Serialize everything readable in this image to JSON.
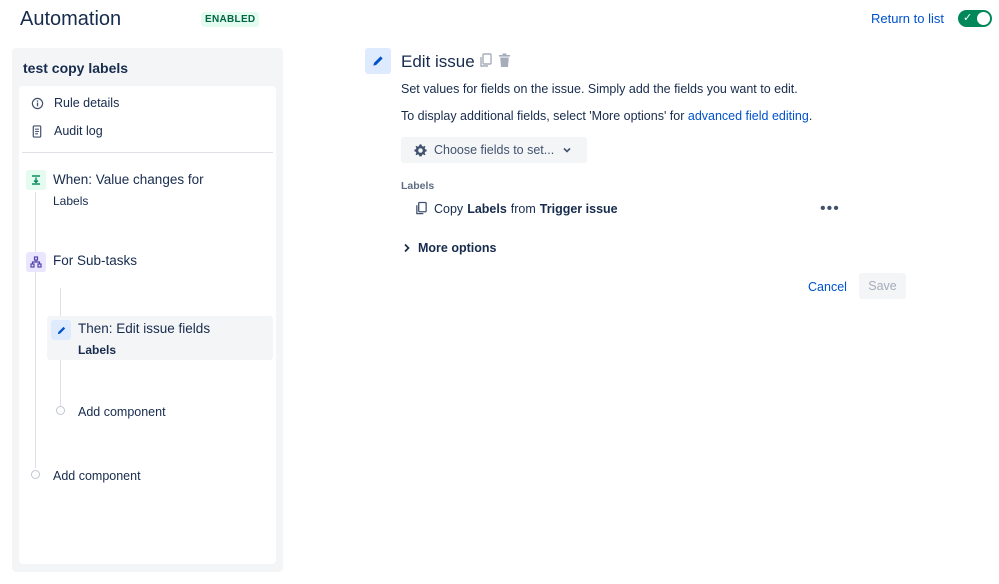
{
  "header": {
    "title": "Automation",
    "status": "ENABLED",
    "return_label": "Return to list",
    "toggle_on": true
  },
  "sidebar": {
    "rule_name": "test copy labels",
    "items": [
      {
        "label": "Rule details",
        "icon": "info-icon"
      },
      {
        "label": "Audit log",
        "icon": "document-icon"
      }
    ],
    "trigger": {
      "label": "When: Value changes for",
      "detail": "Labels",
      "icon": "trigger-icon"
    },
    "branch": {
      "label": "For Sub-tasks",
      "icon": "branch-icon"
    },
    "action": {
      "label": "Then: Edit issue fields",
      "detail": "Labels",
      "icon": "pencil-icon"
    },
    "add_inner": "Add component",
    "add_outer": "Add component"
  },
  "main": {
    "title": "Edit issue",
    "desc1": "Set values for fields on the issue. Simply add the fields you want to edit.",
    "desc2_prefix": "To display additional fields, select 'More options' for ",
    "desc2_link": "advanced field editing",
    "desc2_suffix": ".",
    "choose_label": "Choose fields to set...",
    "field_label": "Labels",
    "field_row": {
      "part1": "Copy",
      "part2": "Labels",
      "part3": "from",
      "part4": "Trigger issue"
    },
    "more_options": "More options",
    "cancel": "Cancel",
    "save": "Save"
  },
  "colors": {
    "accent": "#0052cc",
    "enabled_green": "#00875a",
    "trigger_green": "#e3fcef",
    "branch_purple": "#eae6ff",
    "action_blue": "#deebff"
  }
}
